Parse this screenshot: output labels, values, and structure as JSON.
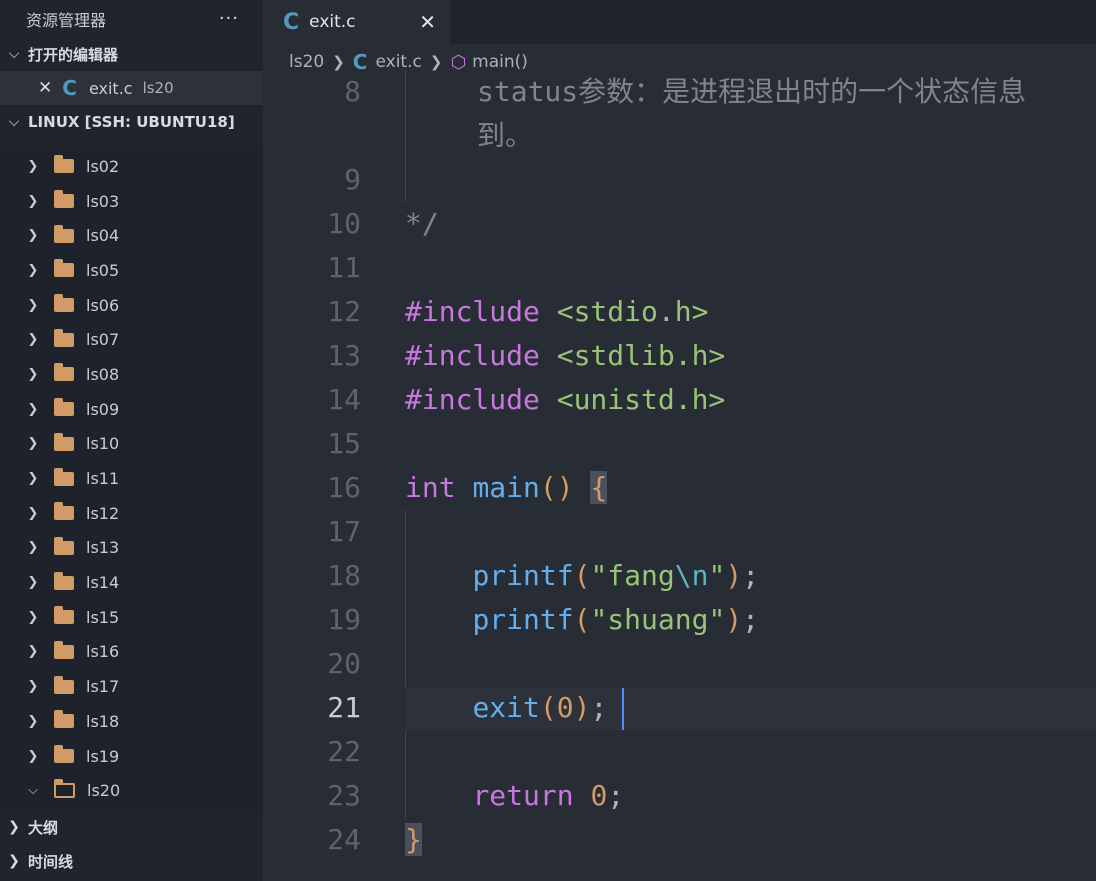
{
  "sidebar": {
    "title": "资源管理器",
    "more": "···",
    "open_editors": {
      "label": "打开的编辑器",
      "items": [
        {
          "close": "✕",
          "icon": "C",
          "name": "exit.c",
          "desc": "ls20"
        }
      ]
    },
    "workspace": {
      "label": "LINUX [SSH: UBUNTU18]"
    },
    "folders": [
      "ls02",
      "ls03",
      "ls04",
      "ls05",
      "ls06",
      "ls07",
      "ls08",
      "ls09",
      "ls10",
      "ls11",
      "ls12",
      "ls13",
      "ls14",
      "ls15",
      "ls16",
      "ls17",
      "ls18",
      "ls19",
      "ls20"
    ],
    "outline": "大纲",
    "timeline": "时间线"
  },
  "tab": {
    "icon": "C",
    "label": "exit.c",
    "close": "✕"
  },
  "breadcrumb": {
    "folder": "ls20",
    "icon": "C",
    "file": "exit.c",
    "symbol": "main()"
  },
  "code": {
    "l8a": "status参数：是进程退出时的一个状态信息",
    "l8b": "到。",
    "l10": "*/",
    "inc_kw": "#include",
    "inc1": "<stdio.h>",
    "inc2": "<stdlib.h>",
    "inc3": "<unistd.h>",
    "l16_int": "int",
    "l16_main": "main",
    "l18_fn": "printf",
    "l18_str1": "\"fang",
    "l18_esc": "\\n",
    "l18_str2": "\"",
    "l19_fn": "printf",
    "l19_str": "\"shuang\"",
    "l21_fn": "exit",
    "l21_num": "0",
    "l23_kw": "return",
    "l23_num": "0",
    "line_numbers": [
      "8",
      "9",
      "10",
      "11",
      "12",
      "13",
      "14",
      "15",
      "16",
      "17",
      "18",
      "19",
      "20",
      "21",
      "22",
      "23",
      "24"
    ]
  },
  "colors": {
    "keyword": "#c678dd",
    "string": "#98c379",
    "function": "#61afef",
    "number": "#d19a66",
    "escape": "#56b6c2",
    "c_icon": "#519aba"
  }
}
